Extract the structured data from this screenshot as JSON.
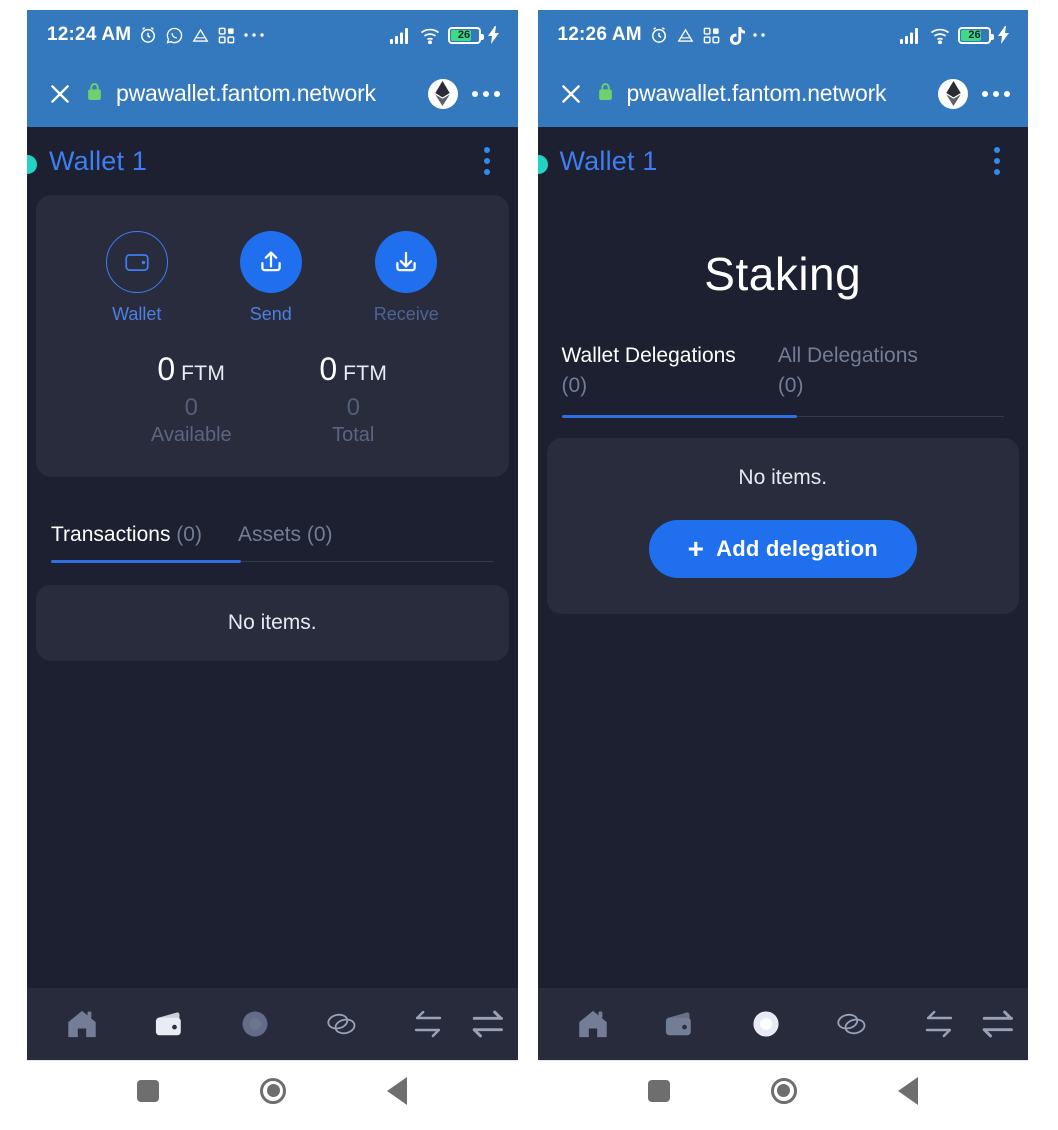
{
  "screens": [
    {
      "id": "wallet-screen",
      "status_bar": {
        "clock": "12:24 AM",
        "icons": [
          "alarm-icon",
          "whatsapp-icon",
          "drive-icon",
          "apps-grid-icon",
          "more-dots-icon"
        ],
        "signal": "signal-bars-icon",
        "wifi": "wifi-icon",
        "battery_level": "26",
        "charging": true
      },
      "browser_bar": {
        "close_label": "✕",
        "lock_icon": "lock-icon",
        "url": "pwawallet.fantom.network",
        "favicon": "ethereum-icon",
        "menu": "overflow-menu-icon"
      },
      "app_header": {
        "status_dot_color": "#22d3c5",
        "title": "Wallet 1",
        "menu_icon": "vertical-kebab-icon"
      },
      "actions": [
        {
          "label": "Wallet",
          "icon": "wallet-icon",
          "style": "outline"
        },
        {
          "label": "Send",
          "icon": "upload-arrow-icon",
          "style": "filled"
        },
        {
          "label": "Receive",
          "icon": "download-arrow-icon",
          "style": "filled"
        }
      ],
      "amounts": [
        {
          "value": "0",
          "unit": "FTM",
          "sub": "0",
          "caption": "Available"
        },
        {
          "value": "0",
          "unit": "FTM",
          "sub": "0",
          "caption": "Total"
        }
      ],
      "tabs": [
        {
          "label": "Transactions",
          "count": "(0)",
          "active": true
        },
        {
          "label": "Assets",
          "count": "(0)",
          "active": false
        }
      ],
      "empty_text": "No items.",
      "bottom_nav": [
        {
          "name": "home-icon",
          "active": false
        },
        {
          "name": "wallet-icon",
          "active": true
        },
        {
          "name": "gem-icon",
          "active": false
        },
        {
          "name": "coins-icon",
          "active": false
        },
        {
          "name": "swap-icon",
          "active": false
        },
        {
          "name": "transfer-icon",
          "active": false
        }
      ]
    },
    {
      "id": "staking-screen",
      "status_bar": {
        "clock": "12:26 AM",
        "icons": [
          "alarm-icon",
          "drive-icon",
          "apps-grid-icon",
          "tiktok-icon",
          "more-dots-icon"
        ],
        "signal": "signal-bars-icon",
        "wifi": "wifi-icon",
        "battery_level": "26",
        "charging": true
      },
      "browser_bar": {
        "close_label": "✕",
        "lock_icon": "lock-icon",
        "url": "pwawallet.fantom.network",
        "favicon": "ethereum-icon",
        "menu": "overflow-menu-icon"
      },
      "app_header": {
        "status_dot_color": "#22d3c5",
        "title": "Wallet 1",
        "menu_icon": "vertical-kebab-icon"
      },
      "page_title": "Staking",
      "tabs": [
        {
          "label": "Wallet Delegations",
          "count": "(0)",
          "active": true
        },
        {
          "label": "All Delegations",
          "count": "(0)",
          "active": false
        }
      ],
      "empty_text": "No items.",
      "primary_button": {
        "label": "Add delegation",
        "icon": "plus-icon"
      },
      "bottom_nav": [
        {
          "name": "home-icon",
          "active": false
        },
        {
          "name": "wallet-icon",
          "active": false
        },
        {
          "name": "gem-icon",
          "active": true
        },
        {
          "name": "coins-icon",
          "active": false
        },
        {
          "name": "swap-icon",
          "active": false
        },
        {
          "name": "transfer-icon",
          "active": false
        }
      ]
    }
  ],
  "system_nav": {
    "recents": "square-recents-icon",
    "home": "circle-home-icon",
    "back": "triangle-back-icon"
  },
  "colors": {
    "browser_blue": "#3479bd",
    "app_bg": "#1c2030",
    "card_bg": "#282c3d",
    "accent_blue": "#1f6fef",
    "title_blue": "#3f7ef0",
    "teal": "#22d3c5",
    "muted": "#737d96"
  }
}
